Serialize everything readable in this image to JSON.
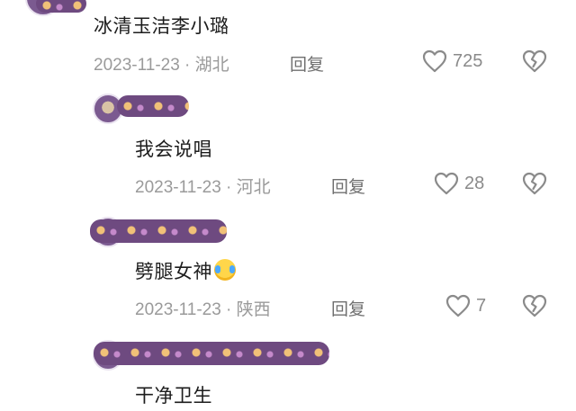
{
  "comments": [
    {
      "text": "冰清玉洁李小璐",
      "date": "2023-11-23",
      "location": "湖北",
      "reply": "回复",
      "likes": "725",
      "emoji": ""
    },
    {
      "text": "我会说唱",
      "date": "2023-11-23",
      "location": "河北",
      "reply": "回复",
      "likes": "28",
      "emoji": ""
    },
    {
      "text": "劈腿女神",
      "date": "2023-11-23",
      "location": "陕西",
      "reply": "回复",
      "likes": "7",
      "emoji": "crying-laughing-emoji"
    },
    {
      "text": "干净卫生",
      "date": "",
      "location": "",
      "reply": "",
      "likes": "",
      "emoji": ""
    }
  ],
  "separator": " · ",
  "icons": {
    "like": "heart-outline-icon",
    "dislike": "broken-heart-icon"
  },
  "colors": {
    "text": "#1d1d1d",
    "meta": "#9a9a9a",
    "icon": "#8a8a8a",
    "redaction": "#6e4a80"
  }
}
